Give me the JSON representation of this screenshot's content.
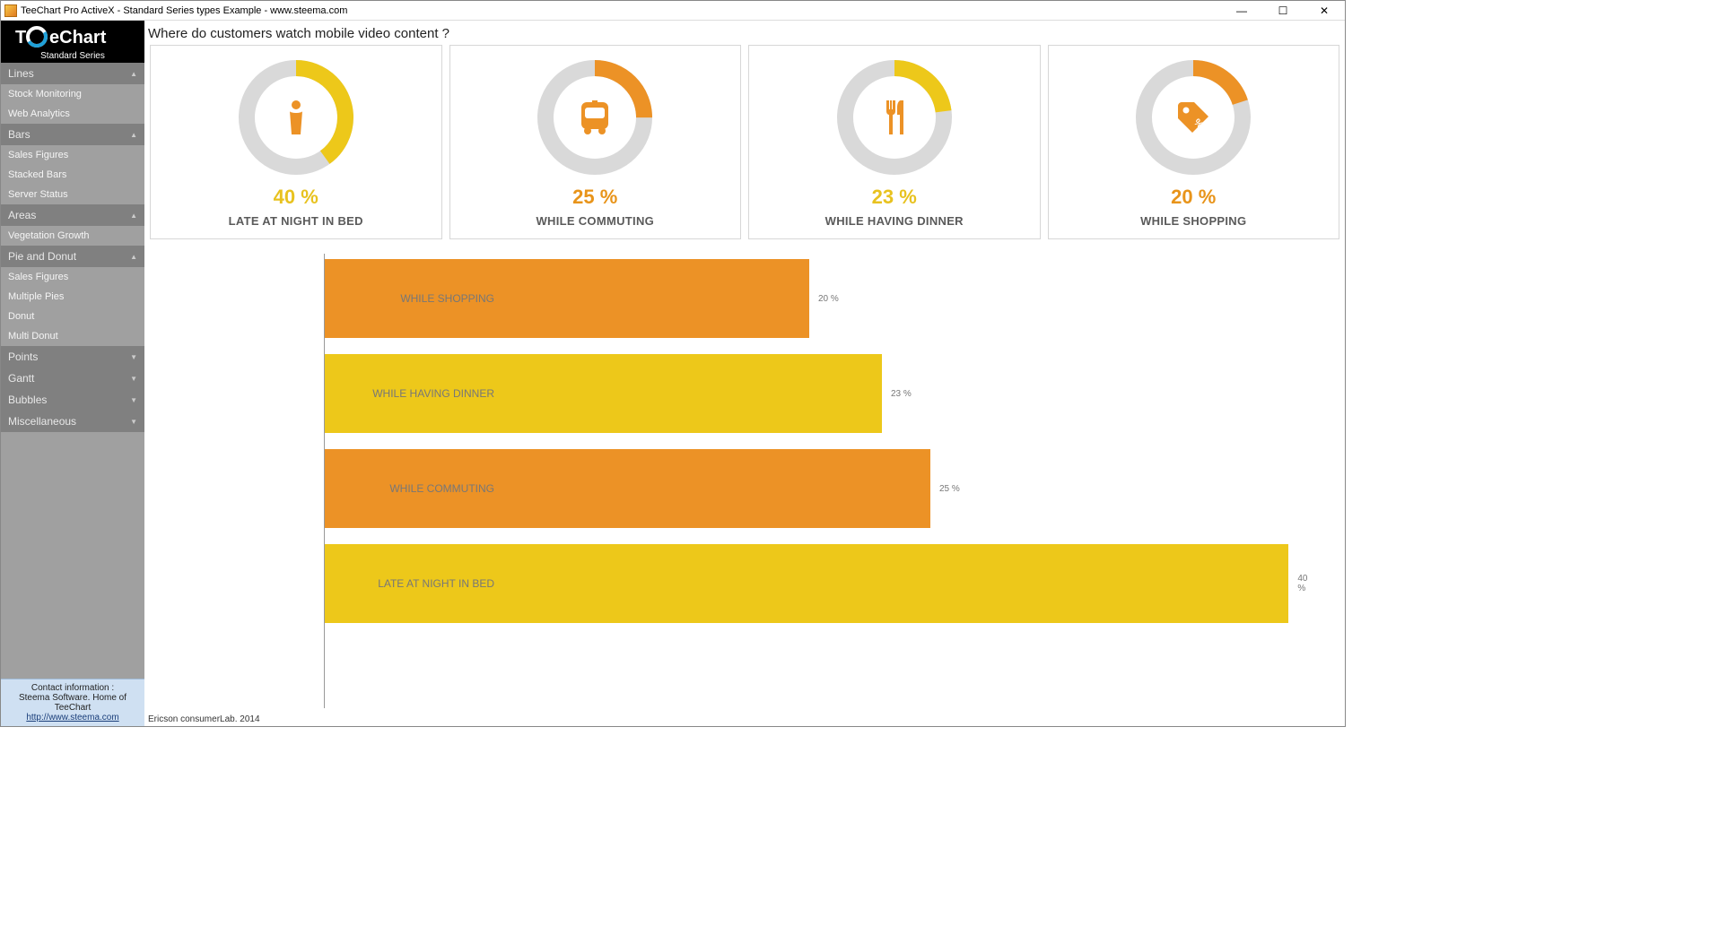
{
  "window": {
    "title": "TeeChart Pro ActiveX - Standard Series types Example - www.steema.com"
  },
  "logo": {
    "subtitle": "Standard Series"
  },
  "sidebar": {
    "categories": [
      {
        "label": "Lines",
        "expanded": true,
        "items": [
          "Stock Monitoring",
          "Web Analytics"
        ]
      },
      {
        "label": "Bars",
        "expanded": true,
        "items": [
          "Sales Figures",
          "Stacked Bars",
          "Server Status"
        ]
      },
      {
        "label": "Areas",
        "expanded": true,
        "items": [
          "Vegetation Growth"
        ]
      },
      {
        "label": "Pie and Donut",
        "expanded": true,
        "items": [
          "Sales Figures",
          "Multiple Pies",
          "Donut",
          "Multi Donut"
        ]
      },
      {
        "label": "Points",
        "expanded": false,
        "items": []
      },
      {
        "label": "Gantt",
        "expanded": false,
        "items": []
      },
      {
        "label": "Bubbles",
        "expanded": false,
        "items": []
      },
      {
        "label": "Miscellaneous",
        "expanded": false,
        "items": []
      }
    ]
  },
  "contact": {
    "line1": "Contact information :",
    "line2": "Steema Software. Home of TeeChart",
    "link": "http://www.steema.com"
  },
  "chart": {
    "title": "Where do customers watch mobile video content ?",
    "credit": "Ericson consumerLab.   2014",
    "cards": [
      {
        "label": "LATE AT NIGHT IN BED",
        "pct": 40,
        "pctText": "40 %",
        "icon": "person-cup",
        "color": "yellow"
      },
      {
        "label": "WHILE COMMUTING",
        "pct": 25,
        "pctText": "25 %",
        "icon": "bus",
        "color": "orange"
      },
      {
        "label": "WHILE HAVING DINNER",
        "pct": 23,
        "pctText": "23 %",
        "icon": "cutlery",
        "color": "yellow"
      },
      {
        "label": "WHILE SHOPPING",
        "pct": 20,
        "pctText": "20 %",
        "icon": "price-tag",
        "color": "orange"
      }
    ]
  },
  "chart_data": {
    "type": "bar",
    "orientation": "horizontal",
    "title": "Where do customers watch mobile video content ?",
    "categories": [
      "WHILE SHOPPING",
      "WHILE HAVING DINNER",
      "WHILE COMMUTING",
      "LATE AT NIGHT IN BED"
    ],
    "values": [
      20,
      23,
      25,
      40
    ],
    "value_labels": [
      "20 %",
      "23 %",
      "25 %",
      "40 %"
    ],
    "colors": [
      "#ec9226",
      "#edc81a",
      "#ec9226",
      "#edc81a"
    ],
    "xlabel": "",
    "ylabel": "",
    "xlim": [
      0,
      40
    ],
    "source": "Ericson consumerLab. 2014",
    "donuts": [
      {
        "label": "LATE AT NIGHT IN BED",
        "value": 40,
        "remainder": 60,
        "accent": "#edc81a"
      },
      {
        "label": "WHILE COMMUTING",
        "value": 25,
        "remainder": 75,
        "accent": "#ec9226"
      },
      {
        "label": "WHILE HAVING DINNER",
        "value": 23,
        "remainder": 77,
        "accent": "#edc81a"
      },
      {
        "label": "WHILE SHOPPING",
        "value": 20,
        "remainder": 80,
        "accent": "#ec9226"
      }
    ]
  }
}
